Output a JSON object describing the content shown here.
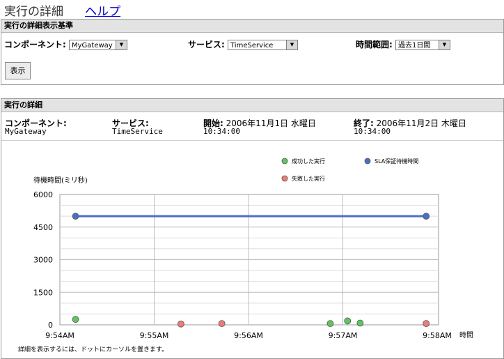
{
  "header": {
    "title": "実行の詳細",
    "help_link": "ヘルプ"
  },
  "criteria": {
    "title": "実行の詳細表示基準",
    "component_label": "コンポーネント:",
    "component_value": "MyGateway",
    "service_label": "サービス:",
    "service_value": "TimeService",
    "time_range_label": "時間範囲:",
    "time_range_value": "過去1日間",
    "show_button": "表示"
  },
  "details": {
    "title": "実行の詳細",
    "component_label": "コンポーネント:",
    "component_value": "MyGateway",
    "service_label": "サービス:",
    "service_value": "TimeService",
    "start_label": "開始:",
    "start_date": "2006年11月1日 水曜日",
    "start_time": "10:34:00",
    "end_label": "終了:",
    "end_date": "2006年11月2日 木曜日",
    "end_time": "10:34:00"
  },
  "chart_data": {
    "type": "scatter",
    "ylabel": "待機時間(ミリ秒)",
    "xlabel": "時間",
    "ylim": [
      0,
      6000
    ],
    "y_ticks": [
      0,
      1500,
      3000,
      4500,
      6000
    ],
    "x_ticks": [
      "9:54AM",
      "9:55AM",
      "9:56AM",
      "9:57AM",
      "9:58AM"
    ],
    "legend": [
      {
        "name": "成功した実行",
        "color": "#5fc65f"
      },
      {
        "name": "SLA保証待機時間",
        "color": "#4a6fc8"
      },
      {
        "name": "失敗した実行",
        "color": "#ee7a7a"
      }
    ],
    "series": [
      {
        "name": "成功した実行",
        "color": "#5fc65f",
        "points": [
          {
            "x": "9:54:10",
            "y": 250
          },
          {
            "x": "9:56:52",
            "y": 60
          },
          {
            "x": "9:57:03",
            "y": 180
          },
          {
            "x": "9:57:11",
            "y": 80
          }
        ]
      },
      {
        "name": "失敗した実行",
        "color": "#ee7a7a",
        "points": [
          {
            "x": "9:55:17",
            "y": 40
          },
          {
            "x": "9:55:43",
            "y": 60
          },
          {
            "x": "9:57:53",
            "y": 60
          }
        ]
      },
      {
        "name": "SLA保証待機時間",
        "color": "#4a6fc8",
        "line": true,
        "points": [
          {
            "x": "9:54:10",
            "y": 5000
          },
          {
            "x": "9:57:53",
            "y": 5000
          }
        ]
      }
    ],
    "grid": true,
    "legend_position": "top-right",
    "footnote": "詳細を表示するには、ドットにカーソルを置きます。"
  }
}
